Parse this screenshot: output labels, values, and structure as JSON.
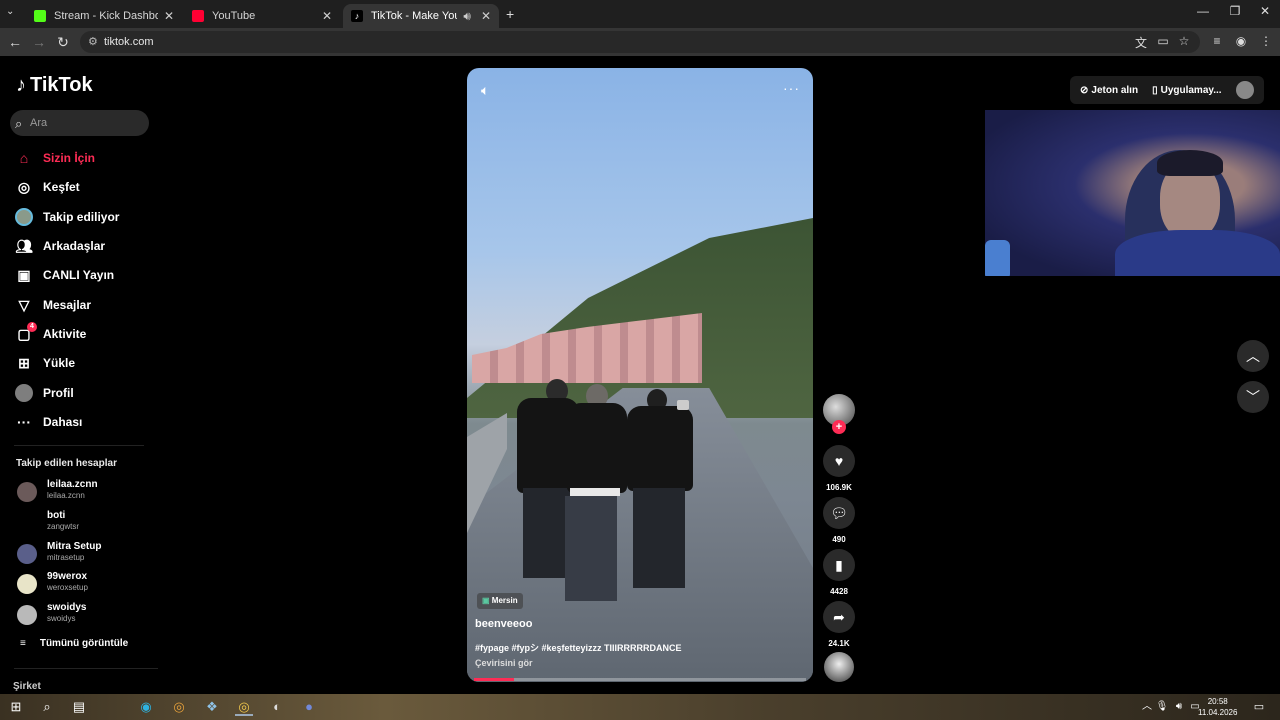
{
  "browser": {
    "tabs": [
      {
        "label": "Stream - Kick Dashboard",
        "color": "#53fc18",
        "active": false
      },
      {
        "label": "YouTube",
        "color": "#ff0033",
        "active": false
      },
      {
        "label": "TikTok - Make Your Day",
        "color": "#ffffff",
        "active": true
      }
    ],
    "url": "tiktok.com"
  },
  "sidebar": {
    "logo": "TikTok",
    "search_placeholder": "Ara",
    "nav": [
      {
        "label": "Sizin İçin",
        "icon": "home-icon",
        "active": true
      },
      {
        "label": "Keşfet",
        "icon": "compass-icon"
      },
      {
        "label": "Takip ediliyor",
        "icon": "following-avatar-icon"
      },
      {
        "label": "Arkadaşlar",
        "icon": "friends-icon"
      },
      {
        "label": "CANLI Yayın",
        "icon": "live-icon"
      },
      {
        "label": "Mesajlar",
        "icon": "messages-icon"
      },
      {
        "label": "Aktivite",
        "icon": "activity-icon",
        "badge": "4"
      },
      {
        "label": "Yükle",
        "icon": "upload-icon"
      },
      {
        "label": "Profil",
        "icon": "profile-icon"
      },
      {
        "label": "Dahası",
        "icon": "more-icon"
      }
    ],
    "following_title": "Takip edilen hesaplar",
    "accounts": [
      {
        "name": "leilaa.zcnn",
        "handle": "leilaa.zcnn"
      },
      {
        "name": "boti",
        "handle": "zangwtsr"
      },
      {
        "name": "Mitra Setup",
        "handle": "mitrasetup"
      },
      {
        "name": "99werox",
        "handle": "weroxsetup"
      },
      {
        "name": "swoidys",
        "handle": "swoidys"
      }
    ],
    "see_all": "Tümünü görüntüle",
    "company": "Şirket"
  },
  "video": {
    "location": "Mersin",
    "author": "beenveeoo",
    "caption": "#fypage #fypシ #keşfetteyizzz TIIIRRRRRDANCE",
    "translate": "Çevirisini gör",
    "progress": 0.12
  },
  "actions": {
    "likes": "106.9K",
    "comments": "490",
    "saves": "4428",
    "shares": "24.1K"
  },
  "topright": {
    "coins": "Jeton alın",
    "app": "Uygulamay..."
  },
  "taskbar": {
    "time": "20:58",
    "date": "11.04.2026"
  }
}
